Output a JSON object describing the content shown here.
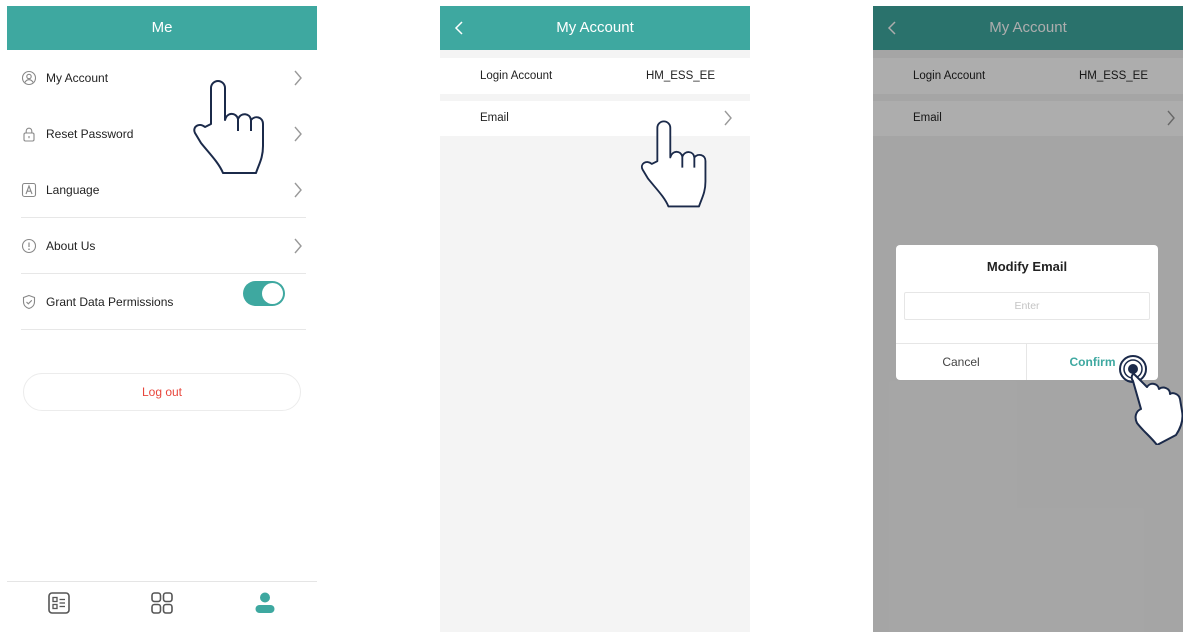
{
  "colors": {
    "accent": "#3ea8a0",
    "danger": "#e8463c",
    "divider": "#e7e7e7"
  },
  "screen1": {
    "title": "Me",
    "menu": [
      {
        "label": "My Account",
        "icon": "user-circle-icon"
      },
      {
        "label": "Reset Password",
        "icon": "lock-icon"
      },
      {
        "label": "Language",
        "icon": "language-icon"
      },
      {
        "label": "About Us",
        "icon": "info-icon"
      },
      {
        "label": "Grant Data Permissions",
        "icon": "shield-check-icon"
      }
    ],
    "grant_permissions_enabled": true,
    "logout_label": "Log out",
    "tabs": [
      {
        "icon": "list-icon",
        "active": false
      },
      {
        "icon": "grid-icon",
        "active": false
      },
      {
        "icon": "person-icon",
        "active": true
      }
    ]
  },
  "screen2": {
    "title": "My Account",
    "login_account_label": "Login Account",
    "login_account_value": "HM_ESS_EE",
    "email_label": "Email"
  },
  "screen3": {
    "title": "My Account",
    "login_account_label": "Login Account",
    "login_account_value": "HM_ESS_EE",
    "email_label": "Email",
    "dialog": {
      "title": "Modify Email",
      "input_placeholder": "Enter",
      "cancel_label": "Cancel",
      "confirm_label": "Confirm"
    }
  }
}
